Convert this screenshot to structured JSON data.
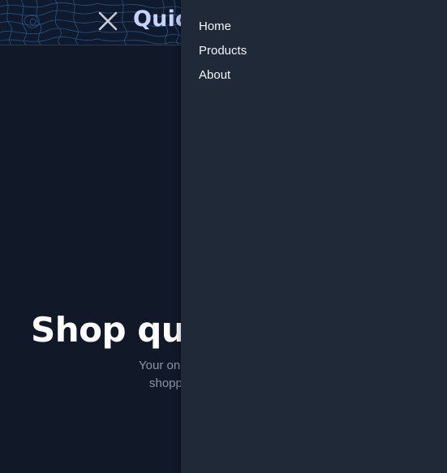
{
  "header": {
    "brand": "Quic",
    "close_icon": "close-icon"
  },
  "hero": {
    "title": "Shop qui",
    "subtitle_line1": "Your on",
    "subtitle_line2": "shopp"
  },
  "drawer": {
    "items": [
      {
        "label": "Home"
      },
      {
        "label": "Products"
      },
      {
        "label": "About"
      }
    ]
  },
  "colors": {
    "background": "#111827",
    "header": "#0f1a2e",
    "drawer": "#1f2937",
    "brand": "#c7d2fe",
    "subtitle": "#8b95a7"
  }
}
